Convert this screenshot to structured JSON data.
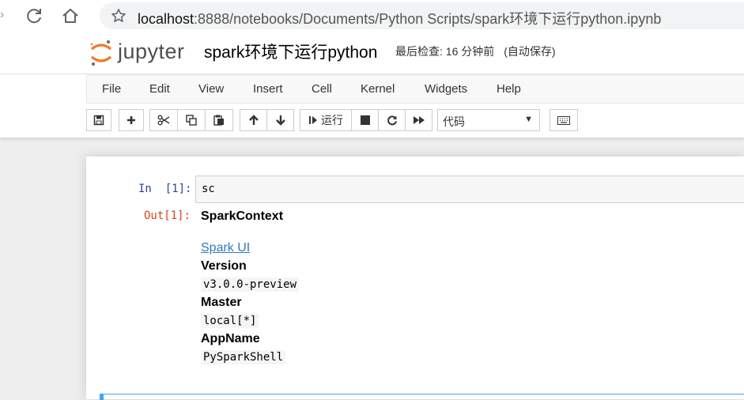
{
  "browser": {
    "url_host": "localhost",
    "url_path": ":8888/notebooks/Documents/Python Scripts/spark环境下运行python.ipynb"
  },
  "header": {
    "logo_text": "jupyter",
    "notebook_name": "spark环境下运行python",
    "checkpoint": "最后检查: 16 分钟前",
    "autosave": "(自动保存)"
  },
  "menu": [
    "File",
    "Edit",
    "View",
    "Insert",
    "Cell",
    "Kernel",
    "Widgets",
    "Help"
  ],
  "toolbar": {
    "run_label": "运行",
    "cell_type": "代码",
    "icons": [
      "save-icon",
      "plus-icon",
      "cut-icon",
      "copy-icon",
      "paste-icon",
      "arrow-up-icon",
      "arrow-down-icon",
      "step-run-icon",
      "stop-icon",
      "restart-icon",
      "fast-forward-icon",
      "keyboard-icon"
    ]
  },
  "cell": {
    "in_prompt": "In  [1]:",
    "code": "sc",
    "out_prompt": "Out[1]:",
    "output": {
      "title": "SparkContext",
      "link": "Spark UI",
      "version_label": "Version",
      "version_value": "v3.0.0-preview",
      "master_label": "Master",
      "master_value": "local[*]",
      "appname_label": "AppName",
      "appname_value": "PySparkShell"
    }
  },
  "colors": {
    "in_prompt": "#303f9f",
    "out_prompt": "#d84315",
    "link": "#337ab7",
    "logo_orange": "#f37626"
  }
}
